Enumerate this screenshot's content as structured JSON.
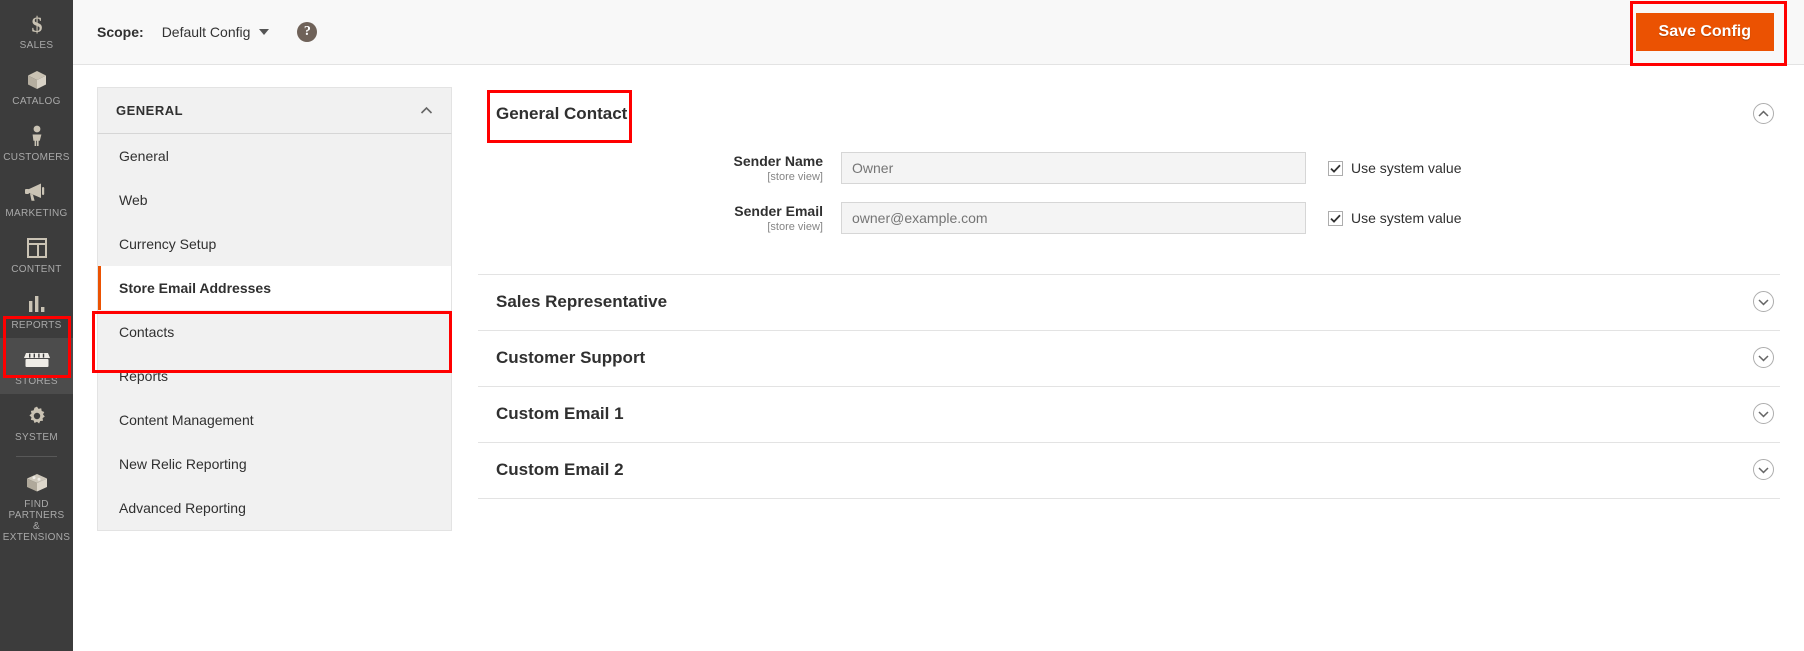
{
  "rail": {
    "items": [
      {
        "label": "SALES",
        "icon": "dollar-icon",
        "active": false
      },
      {
        "label": "CATALOG",
        "icon": "box-icon",
        "active": false
      },
      {
        "label": "CUSTOMERS",
        "icon": "person-icon",
        "active": false
      },
      {
        "label": "MARKETING",
        "icon": "megaphone-icon",
        "active": false
      },
      {
        "label": "CONTENT",
        "icon": "layout-icon",
        "active": false
      },
      {
        "label": "REPORTS",
        "icon": "bar-chart-icon",
        "active": false
      },
      {
        "label": "STORES",
        "icon": "storefront-icon",
        "active": true
      },
      {
        "label": "SYSTEM",
        "icon": "gear-icon",
        "active": false
      },
      {
        "label": "FIND PARTNERS\n& EXTENSIONS",
        "icon": "extension-box-icon",
        "active": false
      }
    ],
    "partners_line1": "FIND PARTNERS",
    "partners_line2": "& EXTENSIONS"
  },
  "header": {
    "scope_label": "Scope:",
    "scope_value": "Default Config",
    "help_glyph": "?",
    "save_label": "Save Config"
  },
  "config_nav": {
    "group_title": "GENERAL",
    "group_chevron": "chevron-up-icon",
    "items": [
      {
        "label": "General",
        "active": false
      },
      {
        "label": "Web",
        "active": false
      },
      {
        "label": "Currency Setup",
        "active": false
      },
      {
        "label": "Store Email Addresses",
        "active": true
      },
      {
        "label": "Contacts",
        "active": false
      },
      {
        "label": "Reports",
        "active": false
      },
      {
        "label": "Content Management",
        "active": false
      },
      {
        "label": "New Relic Reporting",
        "active": false
      },
      {
        "label": "Advanced Reporting",
        "active": false
      }
    ]
  },
  "content": {
    "sections": [
      {
        "title": "General Contact",
        "expanded": true,
        "toggle_icon": "chevron-up-circle-icon",
        "fields": [
          {
            "label": "Sender Name",
            "scope": "[store view]",
            "value": "Owner",
            "placeholder": "Owner",
            "disabled": true,
            "use_system_value": {
              "label": "Use system value",
              "checked": true
            }
          },
          {
            "label": "Sender Email",
            "scope": "[store view]",
            "value": "owner@example.com",
            "placeholder": "owner@example.com",
            "disabled": true,
            "use_system_value": {
              "label": "Use system value",
              "checked": true
            }
          }
        ]
      },
      {
        "title": "Sales Representative",
        "expanded": false,
        "toggle_icon": "chevron-down-circle-icon",
        "fields": []
      },
      {
        "title": "Customer Support",
        "expanded": false,
        "toggle_icon": "chevron-down-circle-icon",
        "fields": []
      },
      {
        "title": "Custom Email 1",
        "expanded": false,
        "toggle_icon": "chevron-down-circle-icon",
        "fields": []
      },
      {
        "title": "Custom Email 2",
        "expanded": false,
        "toggle_icon": "chevron-down-circle-icon",
        "fields": []
      }
    ]
  },
  "annotations": {
    "highlight_color": "#ff0000",
    "targets": [
      "stores-rail-item",
      "save-config-button",
      "store-email-addresses-nav-item",
      "general-contact-section-title"
    ]
  },
  "colors": {
    "accent_orange": "#eb5202",
    "rail_bg": "#3c3c3c",
    "panel_bg": "#f1f1f1"
  }
}
